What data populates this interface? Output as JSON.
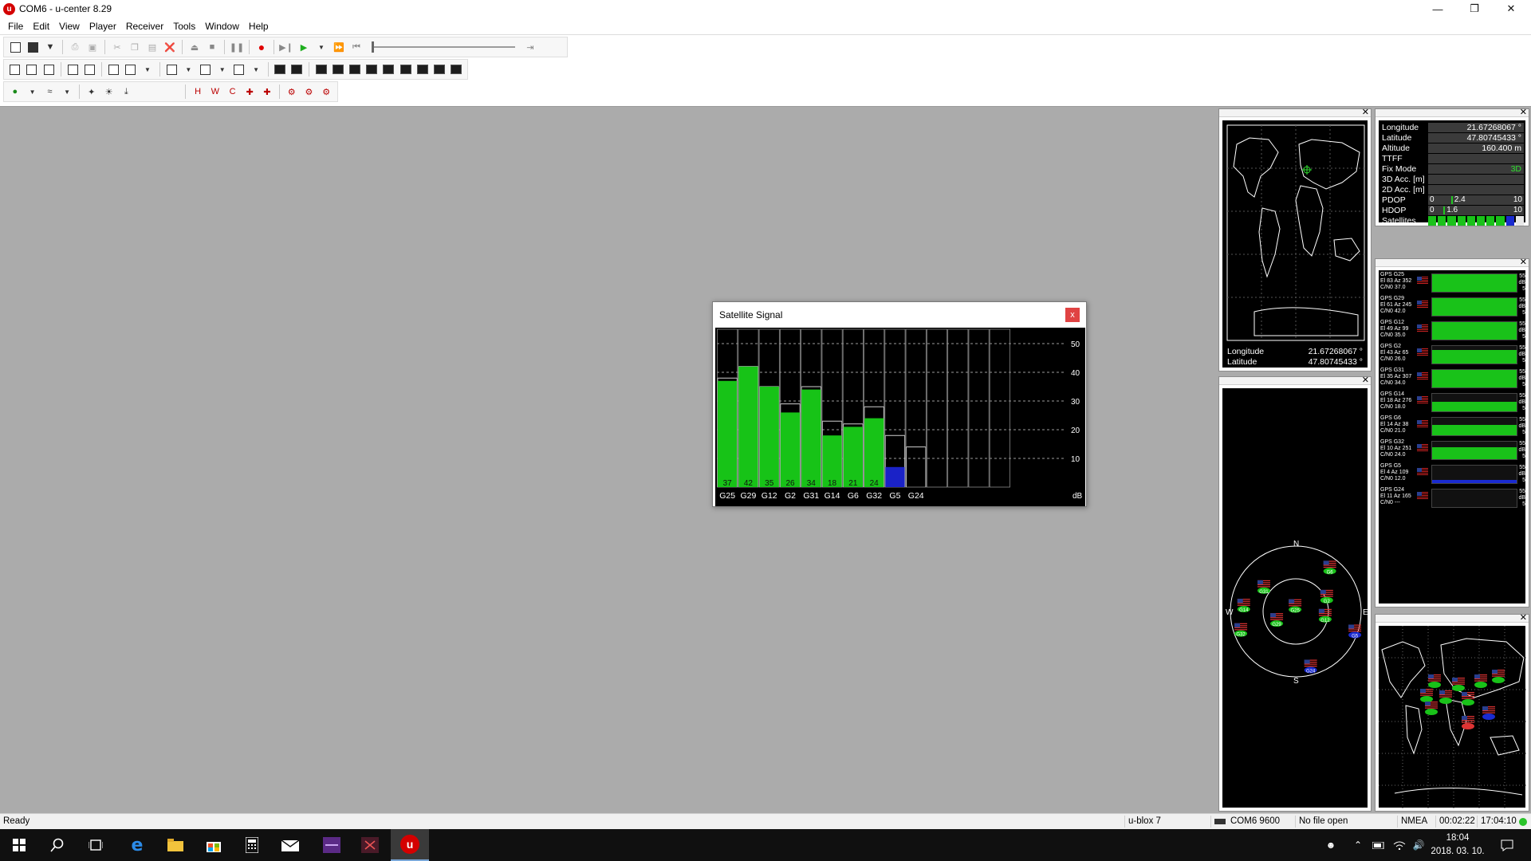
{
  "window": {
    "app_icon_letter": "u",
    "title": "COM6 - u-center 8.29",
    "minimize": "—",
    "restore": "❐",
    "close": "✕"
  },
  "menu": [
    "File",
    "Edit",
    "View",
    "Player",
    "Receiver",
    "Tools",
    "Window",
    "Help"
  ],
  "toolbar": {
    "row3_labels": [
      "H",
      "W",
      "C"
    ]
  },
  "satellite_signal": {
    "title": "Satellite Signal",
    "close_label": "x",
    "unit_label": "dB",
    "y_ticks": [
      50,
      40,
      30,
      20,
      10
    ]
  },
  "chart_data": {
    "type": "bar",
    "title": "Satellite Signal",
    "xlabel": "",
    "ylabel": "dB",
    "ylim": [
      0,
      55
    ],
    "grid": true,
    "categories": [
      "G25",
      "G29",
      "G12",
      "G2",
      "G31",
      "G14",
      "G6",
      "G32",
      "G5",
      "G24",
      "",
      "",
      "",
      ""
    ],
    "values": [
      37,
      42,
      35,
      26,
      34,
      18,
      21,
      24,
      7,
      null,
      null,
      null,
      null,
      null
    ],
    "value_labels": [
      "37",
      "42",
      "35",
      "26",
      "34",
      "18",
      "21",
      "24",
      "",
      "",
      "",
      "",
      "",
      ""
    ],
    "bar_colors": [
      "#17c317",
      "#17c317",
      "#17c317",
      "#17c317",
      "#17c317",
      "#17c317",
      "#17c317",
      "#17c317",
      "#1a22c7",
      null,
      null,
      null,
      null,
      null
    ],
    "outline_values": [
      38,
      42,
      35,
      29,
      35,
      23,
      22,
      28,
      18,
      14,
      null,
      null,
      null,
      null
    ]
  },
  "data_view": {
    "rows": [
      {
        "label": "Longitude",
        "value": "21.67268067 °"
      },
      {
        "label": "Latitude",
        "value": "47.80745433 °"
      },
      {
        "label": "Altitude",
        "value": "160.400 m"
      },
      {
        "label": "TTFF",
        "value": ""
      },
      {
        "label": "Fix Mode",
        "value": "3D"
      },
      {
        "label": "3D Acc. [m]",
        "value": ""
      },
      {
        "label": "2D Acc. [m]",
        "value": ""
      }
    ],
    "pdop": {
      "label": "PDOP",
      "min": "0",
      "value": "2.4",
      "max": "10",
      "fraction": 0.24
    },
    "hdop": {
      "label": "HDOP",
      "min": "0",
      "value": "1.6",
      "max": "10",
      "fraction": 0.16
    },
    "satellites": {
      "label": "Satellites",
      "colors": [
        "#19c219",
        "#19c219",
        "#19c219",
        "#19c219",
        "#19c219",
        "#19c219",
        "#19c219",
        "#19c219",
        "#1a2bd0",
        "#e8e8e8"
      ]
    }
  },
  "world_view": {
    "lon_label": "Longitude",
    "lon_value": "21.67268067 °",
    "lat_label": "Latitude",
    "lat_value": "47.80745433 °"
  },
  "sky_view": {
    "north": "N",
    "south": "S",
    "east": "E",
    "west": "W",
    "satellites": [
      "G25",
      "G29",
      "G12",
      "G2",
      "G31",
      "G14",
      "G6",
      "G32",
      "G5",
      "G24"
    ]
  },
  "level_list": [
    {
      "line1": "GPS G25",
      "line2": "El 83 Az 352",
      "line3": "C/N0 37.0",
      "level": 37,
      "color": "#19c219"
    },
    {
      "line1": "GPS G29",
      "line2": "El 61 Az 245",
      "line3": "C/N0 42.0",
      "level": 42,
      "color": "#19c219"
    },
    {
      "line1": "GPS G12",
      "line2": "El 49 Az 99",
      "line3": "C/N0 35.0",
      "level": 35,
      "color": "#19c219"
    },
    {
      "line1": "GPS G2",
      "line2": "El 43 Az 65",
      "line3": "C/N0 26.0",
      "level": 26,
      "color": "#19c219"
    },
    {
      "line1": "GPS G31",
      "line2": "El 35 Az 307",
      "line3": "C/N0 34.0",
      "level": 34,
      "color": "#19c219"
    },
    {
      "line1": "GPS G14",
      "line2": "El 18 Az 276",
      "line3": "C/N0 18.0",
      "level": 18,
      "color": "#19c219"
    },
    {
      "line1": "GPS G6",
      "line2": "El 14 Az 38",
      "line3": "C/N0 21.0",
      "level": 21,
      "color": "#19c219"
    },
    {
      "line1": "GPS G32",
      "line2": "El 10 Az 251",
      "line3": "C/N0 24.0",
      "level": 24,
      "color": "#19c219"
    },
    {
      "line1": "GPS G5",
      "line2": "El 4 Az 109",
      "line3": "C/N0 12.0",
      "level": 7,
      "color": "#1a2bd0"
    },
    {
      "line1": "GPS G24",
      "line2": "El 11 Az 165",
      "line3": "C/N0 ---",
      "level": 0,
      "color": "#1a2bd0"
    }
  ],
  "level_scale": [
    "55",
    "dB",
    "5"
  ],
  "statusbar": {
    "ready": "Ready",
    "receiver": "u-blox 7",
    "port": "COM6 9600",
    "file": "No file open",
    "protocol": "NMEA",
    "elapsed": "00:02:22",
    "time": "17:04:10"
  },
  "taskbar": {
    "time": "18:04",
    "date": "2018. 03. 10."
  }
}
